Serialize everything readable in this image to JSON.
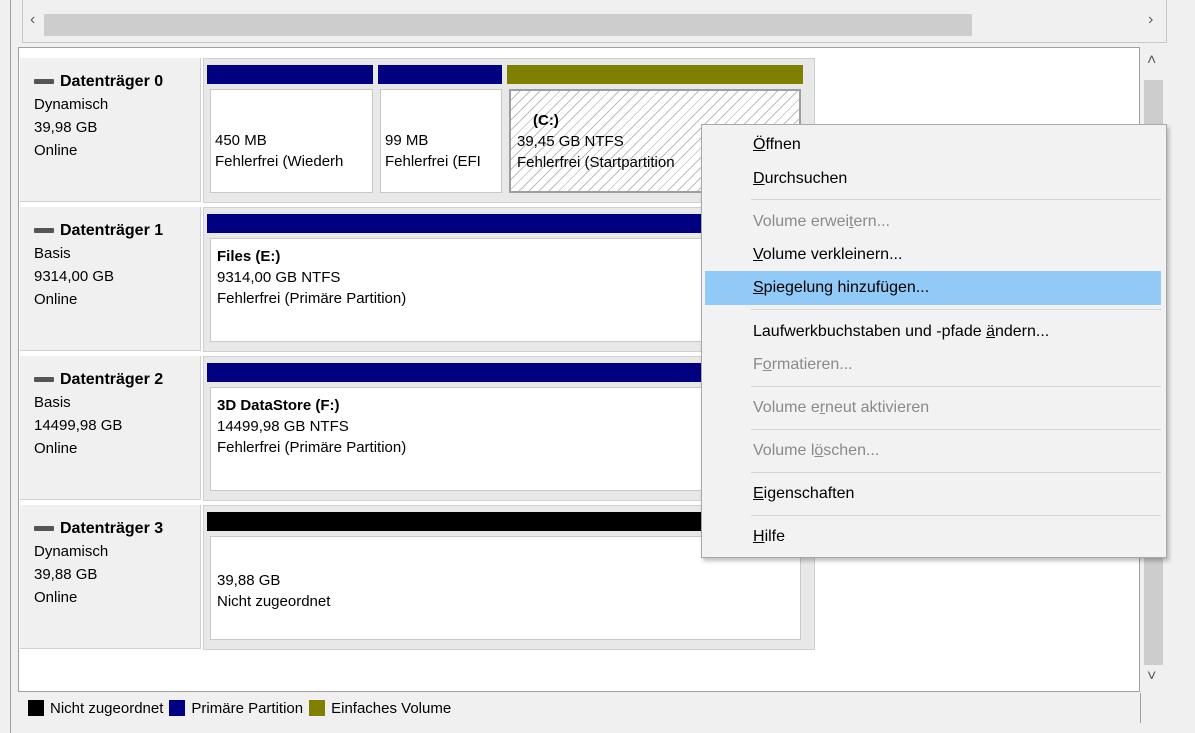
{
  "disks": [
    {
      "name": "Datenträger 0",
      "type": "Dynamisch",
      "size": "39,98 GB",
      "status": "Online",
      "partitions": [
        {
          "title": "",
          "line1": "450 MB",
          "line2": "Fehlerfrei (Wiederh"
        },
        {
          "title": "",
          "line1": "99 MB",
          "line2": "Fehlerfrei (EFI"
        },
        {
          "title": "(C:)",
          "line1": "39,45 GB NTFS",
          "line2": "Fehlerfrei (Startpartition"
        }
      ]
    },
    {
      "name": "Datenträger 1",
      "type": "Basis",
      "size": "9314,00 GB",
      "status": "Online",
      "partitions": [
        {
          "title": "Files  (E:)",
          "line1": "9314,00 GB NTFS",
          "line2": "Fehlerfrei (Primäre Partition)"
        }
      ]
    },
    {
      "name": "Datenträger 2",
      "type": "Basis",
      "size": "14499,98 GB",
      "status": "Online",
      "partitions": [
        {
          "title": "3D DataStore  (F:)",
          "line1": "14499,98 GB NTFS",
          "line2": "Fehlerfrei (Primäre Partition)"
        }
      ]
    },
    {
      "name": "Datenträger 3",
      "type": "Dynamisch",
      "size": "39,88 GB",
      "status": "Online",
      "partitions": [
        {
          "title": "",
          "line1": "39,88 GB",
          "line2": "Nicht zugeordnet"
        }
      ]
    }
  ],
  "context_menu": {
    "items": [
      {
        "pre": "",
        "ul": "Ö",
        "post": "ffnen",
        "disabled": false,
        "highlighted": false
      },
      {
        "pre": "",
        "ul": "D",
        "post": "urchsuchen",
        "disabled": false,
        "highlighted": false
      },
      {
        "pre": "Volume erwei",
        "ul": "t",
        "post": "ern...",
        "disabled": true,
        "highlighted": false
      },
      {
        "pre": "",
        "ul": "V",
        "post": "olume verkleinern...",
        "disabled": false,
        "highlighted": false
      },
      {
        "pre": "",
        "ul": "S",
        "post": "piegelung hinzufügen...",
        "disabled": false,
        "highlighted": true
      },
      {
        "pre": "Laufwerkbuchstaben und -pfade ",
        "ul": "ä",
        "post": "ndern...",
        "disabled": false,
        "highlighted": false
      },
      {
        "pre": "F",
        "ul": "o",
        "post": "rmatieren...",
        "disabled": true,
        "highlighted": false
      },
      {
        "pre": "Volume e",
        "ul": "r",
        "post": "neut aktivieren",
        "disabled": true,
        "highlighted": false
      },
      {
        "pre": "Volume l",
        "ul": "ö",
        "post": "schen...",
        "disabled": true,
        "highlighted": false
      },
      {
        "pre": "",
        "ul": "E",
        "post": "igenschaften",
        "disabled": false,
        "highlighted": false
      },
      {
        "pre": "",
        "ul": "H",
        "post": "ilfe",
        "disabled": false,
        "highlighted": false
      }
    ]
  },
  "legend": [
    {
      "label": "Nicht zugeordnet",
      "color": "#000000"
    },
    {
      "label": "Primäre Partition",
      "color": "#000080"
    },
    {
      "label": "Einfaches Volume",
      "color": "#808000"
    }
  ],
  "colors": {
    "primary": "#000080",
    "simple_volume": "#808000",
    "unallocated": "#000000",
    "menu_highlight": "#91c9f7"
  },
  "icons": {
    "scroll_left": "‹",
    "scroll_right": "›",
    "scroll_up": "˄",
    "scroll_down": "˅"
  }
}
